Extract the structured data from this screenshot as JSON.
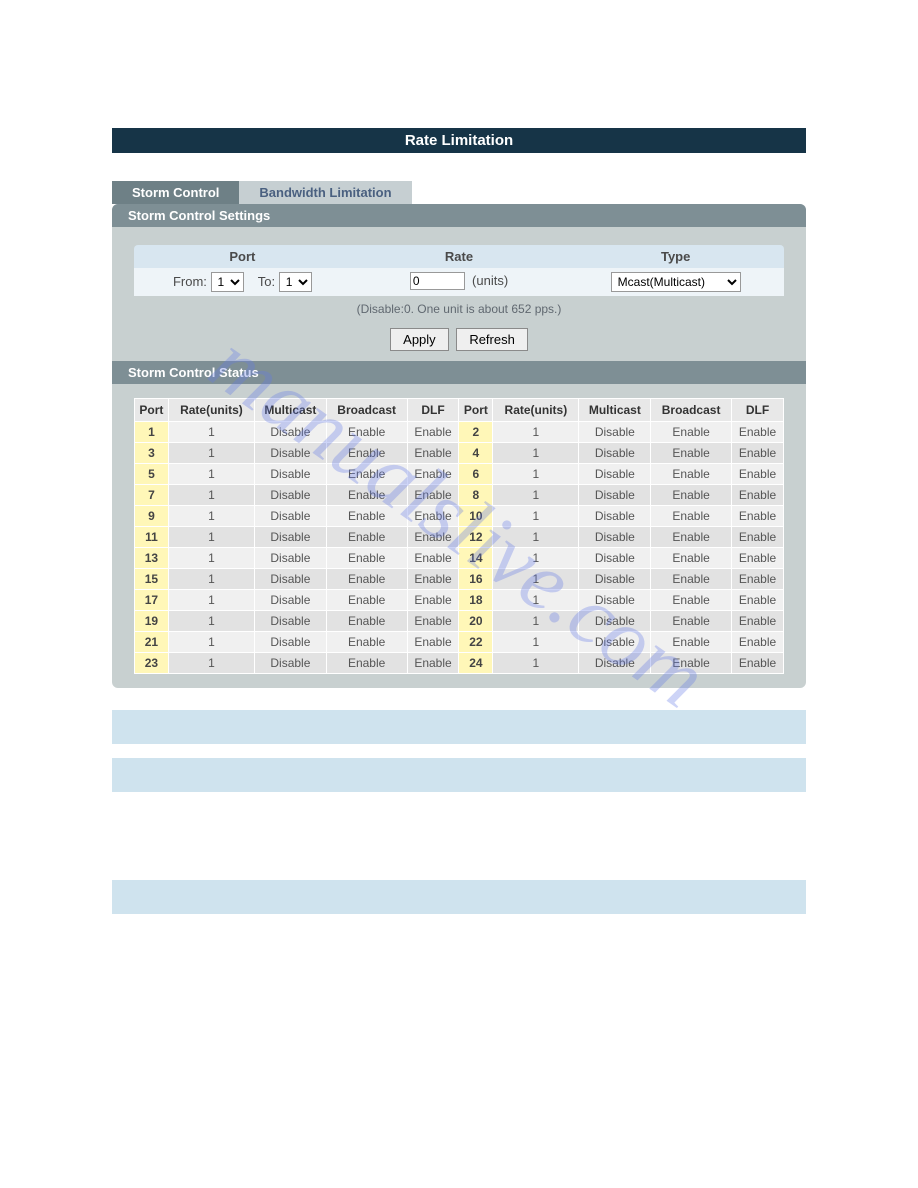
{
  "title": "Rate Limitation",
  "tabs": {
    "active": "Storm Control",
    "inactive": "Bandwidth Limitation"
  },
  "section_settings": "Storm Control Settings",
  "section_status": "Storm Control Status",
  "settings": {
    "port_label": "Port",
    "rate_label": "Rate",
    "type_label": "Type",
    "from_label": "From:",
    "to_label": "To:",
    "from_value": "1",
    "to_value": "1",
    "rate_value": "0",
    "rate_unit": "(units)",
    "type_value": "Mcast(Multicast)",
    "hint": "(Disable:0. One unit is about 652 pps.)"
  },
  "buttons": {
    "apply": "Apply",
    "refresh": "Refresh"
  },
  "status_headers": [
    "Port",
    "Rate(units)",
    "Multicast",
    "Broadcast",
    "DLF"
  ],
  "status_rows": [
    {
      "left": {
        "port": "1",
        "rate": "1",
        "mcast": "Disable",
        "bcast": "Enable",
        "dlf": "Enable"
      },
      "right": {
        "port": "2",
        "rate": "1",
        "mcast": "Disable",
        "bcast": "Enable",
        "dlf": "Enable"
      }
    },
    {
      "left": {
        "port": "3",
        "rate": "1",
        "mcast": "Disable",
        "bcast": "Enable",
        "dlf": "Enable"
      },
      "right": {
        "port": "4",
        "rate": "1",
        "mcast": "Disable",
        "bcast": "Enable",
        "dlf": "Enable"
      }
    },
    {
      "left": {
        "port": "5",
        "rate": "1",
        "mcast": "Disable",
        "bcast": "Enable",
        "dlf": "Enable"
      },
      "right": {
        "port": "6",
        "rate": "1",
        "mcast": "Disable",
        "bcast": "Enable",
        "dlf": "Enable"
      }
    },
    {
      "left": {
        "port": "7",
        "rate": "1",
        "mcast": "Disable",
        "bcast": "Enable",
        "dlf": "Enable"
      },
      "right": {
        "port": "8",
        "rate": "1",
        "mcast": "Disable",
        "bcast": "Enable",
        "dlf": "Enable"
      }
    },
    {
      "left": {
        "port": "9",
        "rate": "1",
        "mcast": "Disable",
        "bcast": "Enable",
        "dlf": "Enable"
      },
      "right": {
        "port": "10",
        "rate": "1",
        "mcast": "Disable",
        "bcast": "Enable",
        "dlf": "Enable"
      }
    },
    {
      "left": {
        "port": "11",
        "rate": "1",
        "mcast": "Disable",
        "bcast": "Enable",
        "dlf": "Enable"
      },
      "right": {
        "port": "12",
        "rate": "1",
        "mcast": "Disable",
        "bcast": "Enable",
        "dlf": "Enable"
      }
    },
    {
      "left": {
        "port": "13",
        "rate": "1",
        "mcast": "Disable",
        "bcast": "Enable",
        "dlf": "Enable"
      },
      "right": {
        "port": "14",
        "rate": "1",
        "mcast": "Disable",
        "bcast": "Enable",
        "dlf": "Enable"
      }
    },
    {
      "left": {
        "port": "15",
        "rate": "1",
        "mcast": "Disable",
        "bcast": "Enable",
        "dlf": "Enable"
      },
      "right": {
        "port": "16",
        "rate": "1",
        "mcast": "Disable",
        "bcast": "Enable",
        "dlf": "Enable"
      }
    },
    {
      "left": {
        "port": "17",
        "rate": "1",
        "mcast": "Disable",
        "bcast": "Enable",
        "dlf": "Enable"
      },
      "right": {
        "port": "18",
        "rate": "1",
        "mcast": "Disable",
        "bcast": "Enable",
        "dlf": "Enable"
      }
    },
    {
      "left": {
        "port": "19",
        "rate": "1",
        "mcast": "Disable",
        "bcast": "Enable",
        "dlf": "Enable"
      },
      "right": {
        "port": "20",
        "rate": "1",
        "mcast": "Disable",
        "bcast": "Enable",
        "dlf": "Enable"
      }
    },
    {
      "left": {
        "port": "21",
        "rate": "1",
        "mcast": "Disable",
        "bcast": "Enable",
        "dlf": "Enable"
      },
      "right": {
        "port": "22",
        "rate": "1",
        "mcast": "Disable",
        "bcast": "Enable",
        "dlf": "Enable"
      }
    },
    {
      "left": {
        "port": "23",
        "rate": "1",
        "mcast": "Disable",
        "bcast": "Enable",
        "dlf": "Enable"
      },
      "right": {
        "port": "24",
        "rate": "1",
        "mcast": "Disable",
        "bcast": "Enable",
        "dlf": "Enable"
      }
    }
  ],
  "watermark": "manualslive.com"
}
